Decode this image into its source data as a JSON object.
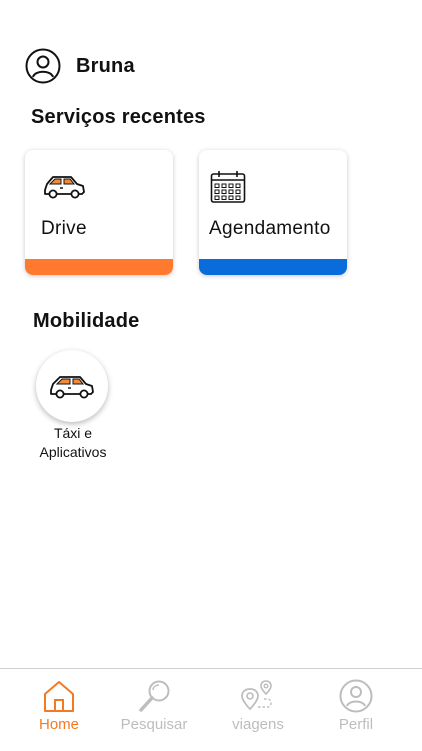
{
  "user": {
    "name": "Bruna",
    "avatar_icon": "user-circle-icon"
  },
  "recent_services": {
    "title": "Serviços recentes",
    "items": [
      {
        "label": "Drive",
        "icon": "car-icon",
        "bar_color": "#FF7A2F"
      },
      {
        "label": "Agendamento",
        "icon": "calendar-icon",
        "bar_color": "#0A6BDB"
      }
    ]
  },
  "mobility": {
    "title": "Mobilidade",
    "items": [
      {
        "label_line1": "Táxi e",
        "label_line2": "Aplicativos",
        "icon": "car-icon"
      }
    ]
  },
  "bottom_nav": {
    "active_color": "#F27A22",
    "inactive_color": "#BDBDBD",
    "items": [
      {
        "label": "Home",
        "icon": "home-icon",
        "active": true
      },
      {
        "label": "Pesquisar",
        "icon": "search-icon",
        "active": false
      },
      {
        "label": "viagens",
        "icon": "route-pin-icon",
        "active": false
      },
      {
        "label": "Perfil",
        "icon": "user-circle-icon",
        "active": false
      }
    ]
  }
}
